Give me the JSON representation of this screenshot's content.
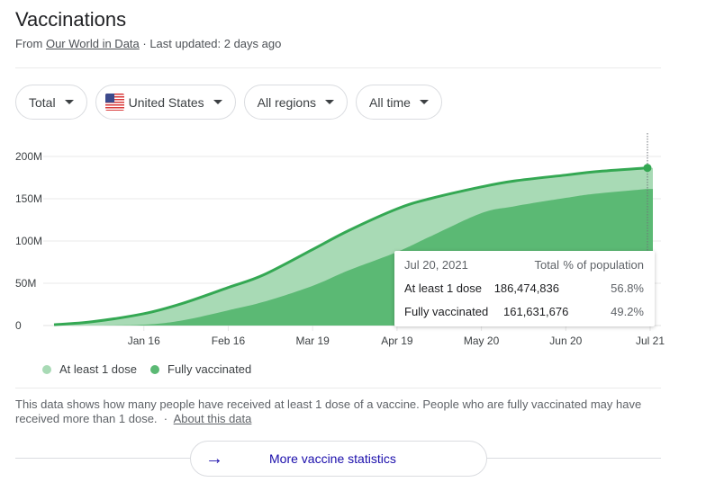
{
  "header": {
    "title": "Vaccinations",
    "source_prefix": "From",
    "source_link": "Our World in Data",
    "updated": "· Last updated: 2 days ago"
  },
  "filters": [
    {
      "label": "Total",
      "icon": "caret-down-icon"
    },
    {
      "label": "United States",
      "icon": "us-flag-icon"
    },
    {
      "label": "All regions",
      "icon": "caret-down-icon"
    },
    {
      "label": "All time",
      "icon": "caret-down-icon"
    }
  ],
  "tooltip": {
    "date": "Jul 20, 2021",
    "col_total": "Total",
    "col_pct": "% of population",
    "rows": [
      {
        "label": "At least 1 dose",
        "total": "186,474,836",
        "pct": "56.8%"
      },
      {
        "label": "Fully vaccinated",
        "total": "161,631,676",
        "pct": "49.2%"
      }
    ]
  },
  "legend": [
    {
      "label": "At least 1 dose",
      "color": "#a8dab5"
    },
    {
      "label": "Fully vaccinated",
      "color": "#5bb974"
    }
  ],
  "description": "This data shows how many people have received at least 1 dose of a vaccine. People who are fully vaccinated may have received more than 1 dose.",
  "about_link": "About this data",
  "more_button": "More vaccine statistics",
  "colors": {
    "line": "#34a853",
    "area_light": "#a8dab5",
    "area_dark": "#5bb974",
    "link_blue": "#1a0dab"
  },
  "chart_data": {
    "type": "area",
    "title": "Vaccinations",
    "xlabel": "",
    "ylabel": "",
    "ylim": [
      0,
      200000000
    ],
    "yticks": [
      {
        "value": 0,
        "label": "0"
      },
      {
        "value": 50000000,
        "label": "50M"
      },
      {
        "value": 100000000,
        "label": "100M"
      },
      {
        "value": 150000000,
        "label": "150M"
      },
      {
        "value": 200000000,
        "label": "200M"
      }
    ],
    "xticks": [
      "Jan 16",
      "Feb 16",
      "Mar 19",
      "Apr 19",
      "May 20",
      "Jun 20",
      "Jul 21"
    ],
    "x": [
      "Dec 14",
      "Dec 28",
      "Jan 16",
      "Jan 30",
      "Feb 16",
      "Mar 1",
      "Mar 19",
      "Apr 1",
      "Apr 19",
      "May 1",
      "May 20",
      "Jun 1",
      "Jun 20",
      "Jul 1",
      "Jul 20"
    ],
    "x_day_index": [
      0,
      14,
      33,
      47,
      64,
      77,
      95,
      108,
      126,
      138,
      157,
      169,
      188,
      199,
      218
    ],
    "xtick_day_index": [
      33,
      64,
      95,
      126,
      157,
      188,
      219
    ],
    "xlim_days": [
      0,
      219
    ],
    "series": [
      {
        "name": "At least 1 dose",
        "values": [
          1000000,
          4500000,
          14000000,
          26000000,
          45000000,
          60000000,
          90000000,
          112000000,
          138000000,
          150000000,
          164000000,
          171000000,
          178000000,
          182000000,
          186474836
        ]
      },
      {
        "name": "Fully vaccinated",
        "values": [
          0,
          0,
          1000000,
          6000000,
          18000000,
          28000000,
          47000000,
          65000000,
          87000000,
          105000000,
          133000000,
          141000000,
          151000000,
          156000000,
          161631676
        ]
      }
    ],
    "grid": true,
    "legend_position": "bottom-left",
    "highlight": {
      "date": "Jul 20, 2021",
      "series": "At least 1 dose",
      "value": 186474836
    }
  }
}
